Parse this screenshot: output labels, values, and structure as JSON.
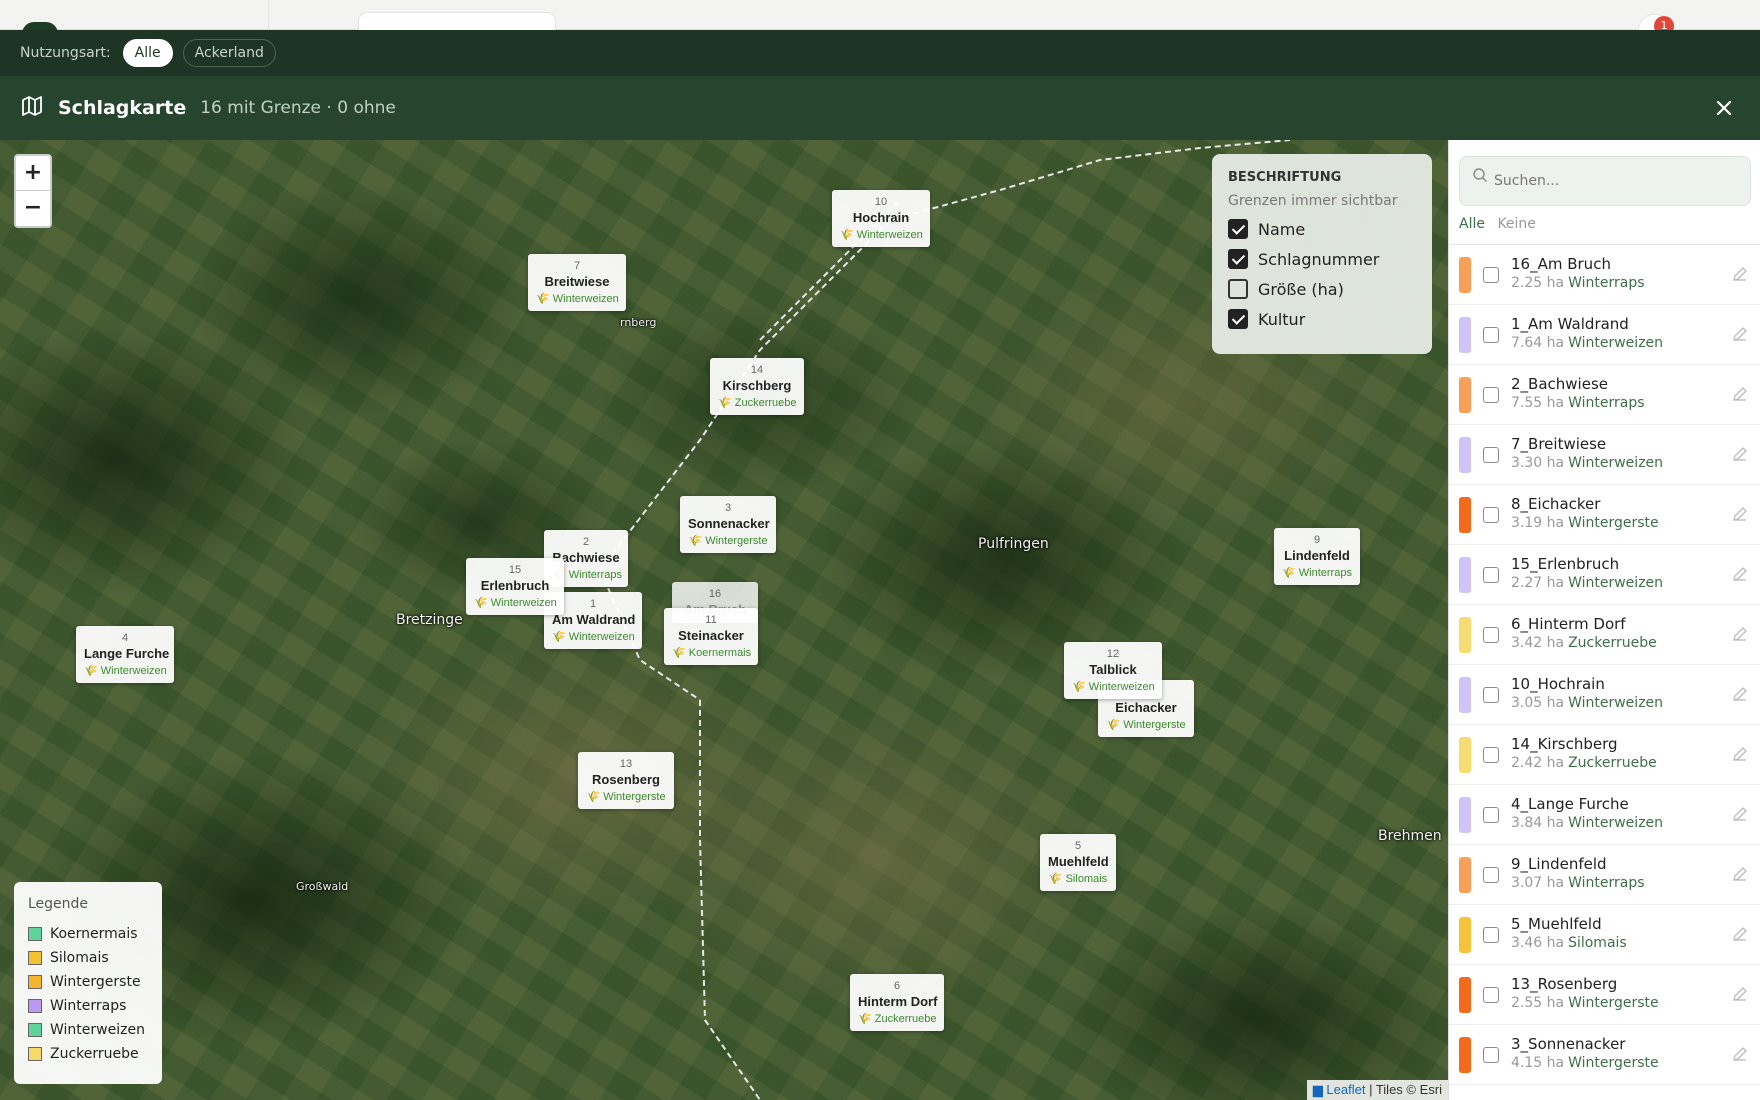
{
  "topbar": {
    "notification_count": "1"
  },
  "filter": {
    "label": "Nutzungsart:",
    "chips": [
      "Alle",
      "Ackerland"
    ],
    "active": "Alle"
  },
  "header": {
    "title": "Schlagkarte",
    "subtitle": "16 mit Grenze · 0 ohne"
  },
  "map": {
    "zoom_in": "+",
    "zoom_out": "−",
    "places": [
      {
        "name": "Pulfringen"
      },
      {
        "name": "Bretzinge"
      },
      {
        "name": "Brehmen"
      },
      {
        "name": "Großwald"
      },
      {
        "name": "rnberg"
      }
    ],
    "markers": [
      {
        "num": "10",
        "name": "Hochrain",
        "crop": "Winterweizen"
      },
      {
        "num": "7",
        "name": "Breitwiese",
        "crop": "Winterweizen"
      },
      {
        "num": "14",
        "name": "Kirschberg",
        "crop": "Zuckerruebe"
      },
      {
        "num": "3",
        "name": "Sonnenacker",
        "crop": "Wintergerste"
      },
      {
        "num": "2",
        "name": "Bachwiese",
        "crop": "Winterraps"
      },
      {
        "num": "15",
        "name": "Erlenbruch",
        "crop": "Winterweizen"
      },
      {
        "num": "1",
        "name": "Am Waldrand",
        "crop": "Winterweizen"
      },
      {
        "num": "16",
        "name": "Am Bruch",
        "crop": "Winterraps"
      },
      {
        "num": "11",
        "name": "Steinacker",
        "crop": "Koernermais"
      },
      {
        "num": "9",
        "name": "Lindenfeld",
        "crop": "Winterraps"
      },
      {
        "num": "4",
        "name": "Lange Furche",
        "crop": "Winterweizen"
      },
      {
        "num": "12",
        "name": "Talblick",
        "crop": "Winterweizen"
      },
      {
        "num": "8",
        "name": "Eichacker",
        "crop": "Wintergerste"
      },
      {
        "num": "13",
        "name": "Rosenberg",
        "crop": "Wintergerste"
      },
      {
        "num": "5",
        "name": "Muehlfeld",
        "crop": "Silomais"
      },
      {
        "num": "6",
        "name": "Hinterm Dorf",
        "crop": "Zuckerruebe"
      }
    ],
    "label_panel": {
      "title": "BESCHRIFTUNG",
      "subtitle": "Grenzen immer sichtbar",
      "options": [
        {
          "label": "Name",
          "checked": true
        },
        {
          "label": "Schlagnummer",
          "checked": true
        },
        {
          "label": "Größe (ha)",
          "checked": false
        },
        {
          "label": "Kultur",
          "checked": true
        }
      ]
    },
    "legend": {
      "title": "Legende",
      "items": [
        {
          "label": "Koernermais",
          "color": "#5fd39a"
        },
        {
          "label": "Silomais",
          "color": "#f2c230"
        },
        {
          "label": "Wintergerste",
          "color": "#f5b52e"
        },
        {
          "label": "Winterraps",
          "color": "#b99af0"
        },
        {
          "label": "Winterweizen",
          "color": "#5fd39a"
        },
        {
          "label": "Zuckerruebe",
          "color": "#f7d96a"
        }
      ]
    },
    "attribution": {
      "leaflet": "Leaflet",
      "rest": " | Tiles © Esri"
    }
  },
  "sidebar": {
    "search_placeholder": "Suchen...",
    "select_all": "Alle",
    "select_none": "Keine",
    "fields": [
      {
        "name": "16_Am Bruch",
        "area": "2.25 ha",
        "crop": "Winterraps",
        "color": "#f6a05a"
      },
      {
        "name": "1_Am Waldrand",
        "area": "7.64 ha",
        "crop": "Winterweizen",
        "color": "#cfc4f5"
      },
      {
        "name": "2_Bachwiese",
        "area": "7.55 ha",
        "crop": "Winterraps",
        "color": "#f6a05a"
      },
      {
        "name": "7_Breitwiese",
        "area": "3.30 ha",
        "crop": "Winterweizen",
        "color": "#cfc4f5"
      },
      {
        "name": "8_Eichacker",
        "area": "3.19 ha",
        "crop": "Wintergerste",
        "color": "#f26a1b"
      },
      {
        "name": "15_Erlenbruch",
        "area": "2.27 ha",
        "crop": "Winterweizen",
        "color": "#cfc4f5"
      },
      {
        "name": "6_Hinterm Dorf",
        "area": "3.42 ha",
        "crop": "Zuckerruebe",
        "color": "#f7dc72"
      },
      {
        "name": "10_Hochrain",
        "area": "3.05 ha",
        "crop": "Winterweizen",
        "color": "#cfc4f5"
      },
      {
        "name": "14_Kirschberg",
        "area": "2.42 ha",
        "crop": "Zuckerruebe",
        "color": "#f7dc72"
      },
      {
        "name": "4_Lange Furche",
        "area": "3.84 ha",
        "crop": "Winterweizen",
        "color": "#cfc4f5"
      },
      {
        "name": "9_Lindenfeld",
        "area": "3.07 ha",
        "crop": "Winterraps",
        "color": "#f6a05a"
      },
      {
        "name": "5_Muehlfeld",
        "area": "3.46 ha",
        "crop": "Silomais",
        "color": "#f5c33a"
      },
      {
        "name": "13_Rosenberg",
        "area": "2.55 ha",
        "crop": "Wintergerste",
        "color": "#f26a1b"
      },
      {
        "name": "3_Sonnenacker",
        "area": "4.15 ha",
        "crop": "Wintergerste",
        "color": "#f26a1b"
      }
    ]
  }
}
